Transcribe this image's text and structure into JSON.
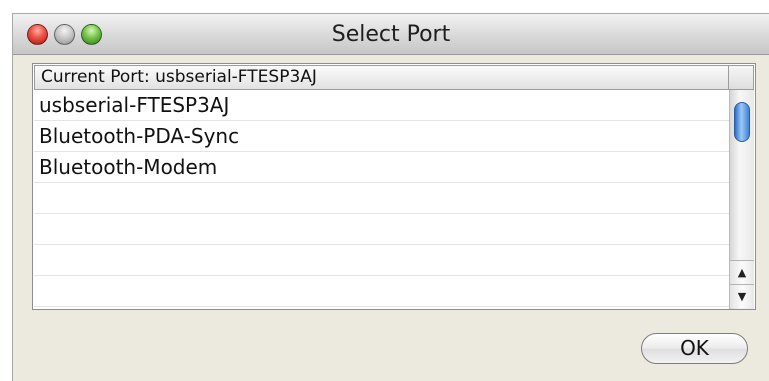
{
  "window": {
    "title": "Select Port"
  },
  "table": {
    "header": "Current Port: usbserial-FTESP3AJ",
    "rows": [
      "usbserial-FTESP3AJ",
      "Bluetooth-PDA-Sync",
      "Bluetooth-Modem",
      "",
      "",
      "",
      ""
    ]
  },
  "buttons": {
    "ok_label": "OK"
  },
  "icons": {
    "close": "close-icon",
    "minimize": "minimize-icon",
    "zoom": "zoom-icon",
    "scroll_up": "scroll-up-arrow-icon",
    "scroll_down": "scroll-down-arrow-icon"
  },
  "colors": {
    "window_bg": "#ece9df",
    "close": "#e8473b",
    "minimize": "#c9c9c9",
    "zoom": "#69bd44",
    "scroll_thumb": "#3f83d8"
  }
}
